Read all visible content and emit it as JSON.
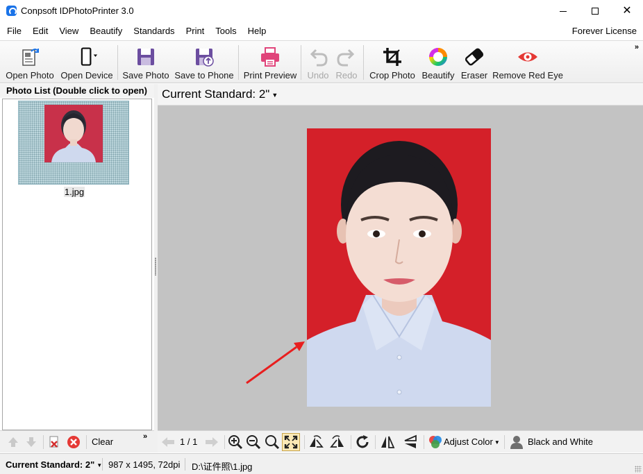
{
  "window": {
    "title": "Conpsoft IDPhotoPrinter 3.0",
    "minimize_icon": "minimize-icon",
    "maximize_icon": "maximize-icon",
    "close_icon": "close-icon"
  },
  "menu": {
    "items": [
      "File",
      "Edit",
      "View",
      "Beautify",
      "Standards",
      "Print",
      "Tools",
      "Help"
    ],
    "license": "Forever License"
  },
  "toolbar": {
    "open_photo": "Open Photo",
    "open_device": "Open Device",
    "save_photo": "Save Photo",
    "save_to_phone": "Save to Phone",
    "print_preview": "Print Preview",
    "undo": "Undo",
    "redo": "Redo",
    "crop_photo": "Crop Photo",
    "beautify": "Beautify",
    "eraser": "Eraser",
    "remove_red_eye": "Remove Red Eye",
    "more": "»"
  },
  "photo_list": {
    "header": "Photo List (Double click to open)",
    "items": [
      {
        "name": "1.jpg"
      }
    ],
    "clear_label": "Clear",
    "more": "»"
  },
  "main": {
    "current_standard": "Current Standard: 2\"",
    "photo_background": "#d42029"
  },
  "bottom_toolbar": {
    "page": "1 / 1",
    "adjust_color": "Adjust Color",
    "black_and_white": "Black and White"
  },
  "status": {
    "standard": "Current Standard: 2\"",
    "dimensions": "987 x 1495, 72dpi",
    "path": "D:\\证件照\\1.jpg"
  },
  "colors": {
    "photo_red": "#d42029",
    "accent_blue": "#1a73e8",
    "print_pink": "#e0447a",
    "save_purple": "#6c4ea0",
    "red_eye": "#e53935"
  }
}
